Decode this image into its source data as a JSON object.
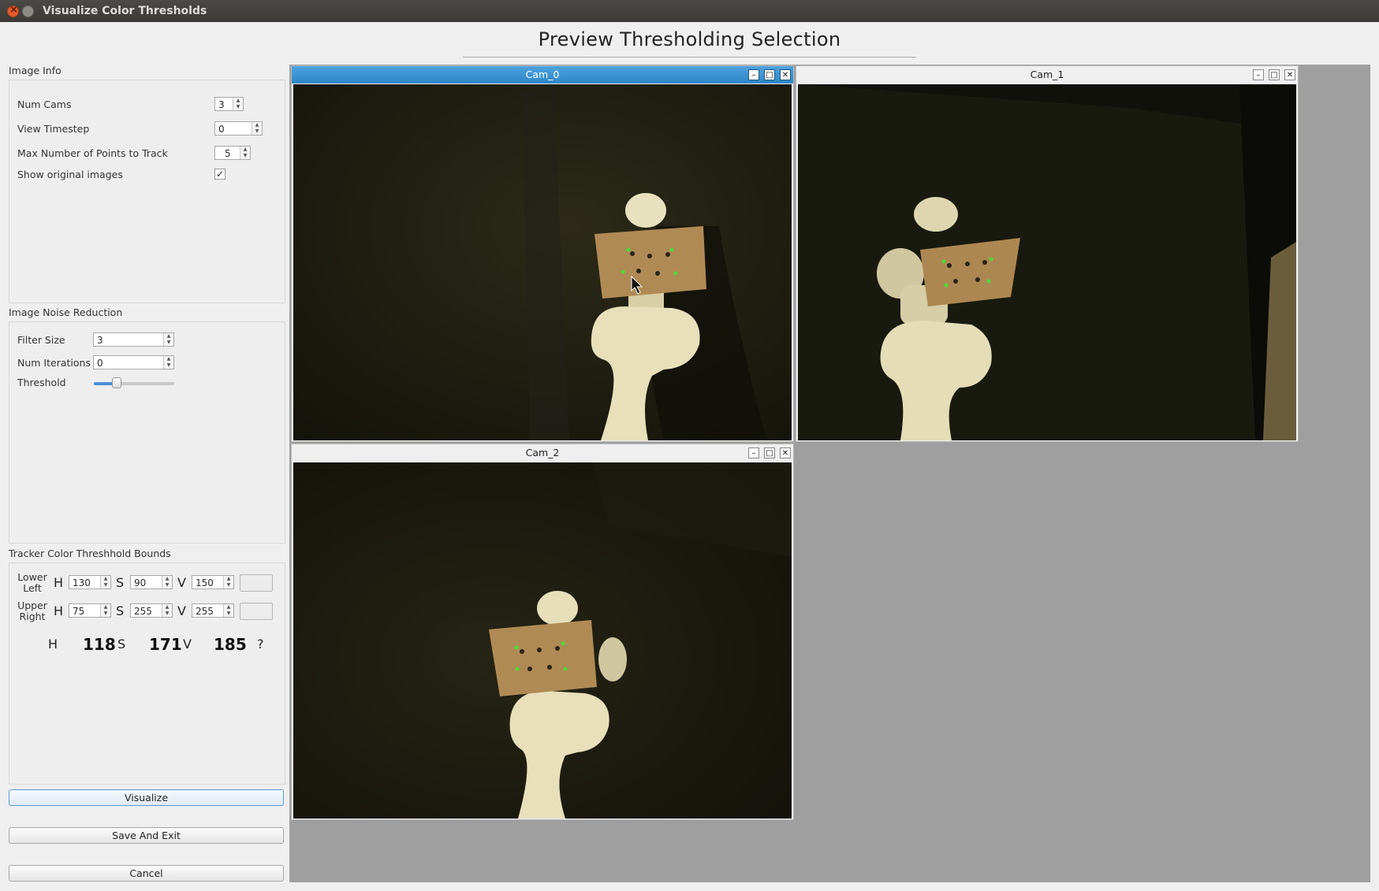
{
  "window": {
    "title": "Visualize Color Thresholds"
  },
  "heading": "Preview Thresholding Selection",
  "image_info": {
    "group_label": "Image Info",
    "num_cams_label": "Num Cams",
    "num_cams": "3",
    "view_timestep_label": "View Timestep",
    "view_timestep": "0",
    "max_points_label": "Max Number of Points to Track",
    "max_points": "5",
    "show_original_label": "Show original images",
    "show_original": "✓"
  },
  "noise_reduction": {
    "group_label": "Image Noise Reduction",
    "filter_size_label": "Filter Size",
    "filter_size": "3",
    "num_iterations_label": "Num Iterations",
    "num_iterations": "0",
    "threshold_label": "Threshold",
    "threshold_level": 0.25
  },
  "tracker_bounds": {
    "group_label": "Tracker Color Threshhold Bounds",
    "lower_label_1": "Lower",
    "lower_label_2": "Left",
    "upper_label_1": "Upper",
    "upper_label_2": "Right",
    "h": "H",
    "s": "S",
    "v": "V",
    "lower": {
      "h": "130",
      "s": "90",
      "v": "150"
    },
    "upper": {
      "h": "75",
      "s": "255",
      "v": "255"
    },
    "readout": {
      "h_label": "H",
      "h": "118",
      "s_label": "S",
      "s": "171",
      "v_label": "V",
      "v": "185",
      "q": "?"
    }
  },
  "buttons": {
    "visualize": "Visualize",
    "save_exit": "Save And Exit",
    "cancel": "Cancel"
  },
  "cameras": [
    {
      "title": "Cam_0"
    },
    {
      "title": "Cam_1"
    },
    {
      "title": "Cam_2"
    }
  ],
  "colors": {
    "accent": "#2f86c6",
    "mdi_background": "#9f9f9f",
    "marker_green": "#4cd93c"
  }
}
